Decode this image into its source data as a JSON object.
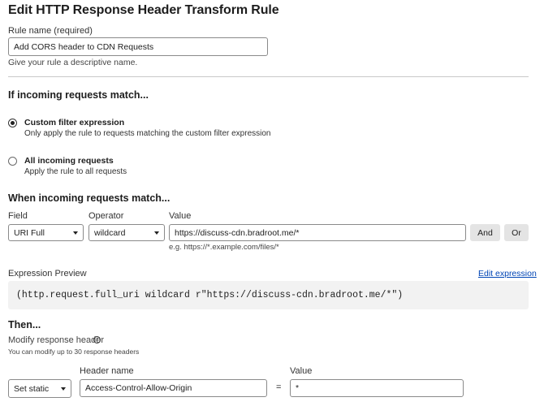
{
  "page": {
    "title": "Edit HTTP Response Header Transform Rule"
  },
  "rule_name": {
    "label": "Rule name (required)",
    "value": "Add CORS header to CDN Requests",
    "hint": "Give your rule a descriptive name."
  },
  "match_section": {
    "title": "If incoming requests match...",
    "options": [
      {
        "title": "Custom filter expression",
        "description": "Only apply the rule to requests matching the custom filter expression",
        "checked": true
      },
      {
        "title": "All incoming requests",
        "description": "Apply the rule to all requests",
        "checked": false
      }
    ]
  },
  "filter": {
    "title": "When incoming requests match...",
    "field_label": "Field",
    "field_value": "URI Full",
    "operator_label": "Operator",
    "operator_value": "wildcard",
    "value_label": "Value",
    "value_value": "https://discuss-cdn.bradroot.me/*",
    "value_example": "e.g. https://*.example.com/files/*",
    "and_label": "And",
    "or_label": "Or"
  },
  "expression": {
    "label": "Expression Preview",
    "edit_link": "Edit expression",
    "code": "(http.request.full_uri wildcard r\"https://discuss-cdn.bradroot.me/*\")"
  },
  "then": {
    "title": "Then...",
    "modify_label": "Modify response header",
    "modify_hint": "You can modify up to 30 response headers",
    "action_value": "Set static",
    "header_name_label": "Header name",
    "header_name_value": "Access-Control-Allow-Origin",
    "equals": "=",
    "value_label": "Value",
    "value_value": "*"
  },
  "colors": {
    "link": "#0045b5",
    "button_bg": "#e4e4e4",
    "code_bg": "#f2f2f2"
  }
}
